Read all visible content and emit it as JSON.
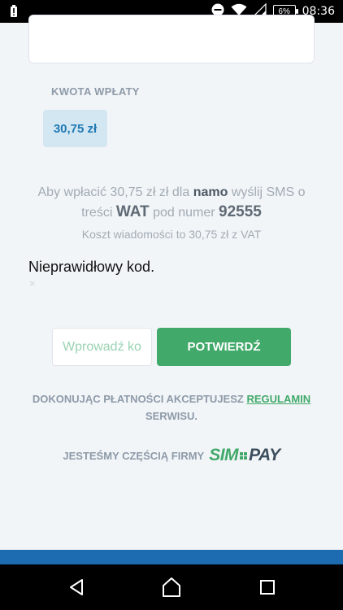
{
  "status_bar": {
    "battery_percent": "6%",
    "time": "08:36",
    "icons": [
      "battery-alert-icon",
      "do-not-disturb-icon",
      "wifi-icon",
      "signal-icon"
    ]
  },
  "payment": {
    "amount_label": "KWOTA WPŁATY",
    "amount_value": "30,75 zł",
    "instruction_pre": "Aby wpłacić 30,75 zł zł dla ",
    "instruction_name": "namo",
    "instruction_mid": " wyślij SMS o treści ",
    "sms_text": "WAT",
    "instruction_mid2": " pod numer ",
    "sms_number": "92555",
    "cost_text": "Koszt wiadomości to 30,75 zł z VAT"
  },
  "error": {
    "message": "Nieprawidłowy kod.",
    "close": "×"
  },
  "form": {
    "code_placeholder": "Wprowadź kod",
    "confirm_label": "POTWIERDŹ"
  },
  "terms": {
    "pre": "DOKONUJĄC PŁATNOŚCI AKCEPTUJESZ ",
    "link": "REGULAMIN",
    "post": " SERWISU."
  },
  "footer": {
    "part_of": "JESTEŚMY CZĘŚCIĄ FIRMY",
    "logo_sim": "SIM",
    "logo_pay": "PAY"
  },
  "colors": {
    "accent_green": "#41a96a",
    "accent_blue": "#2079b3",
    "bottom_strip": "#1d6bb0"
  }
}
